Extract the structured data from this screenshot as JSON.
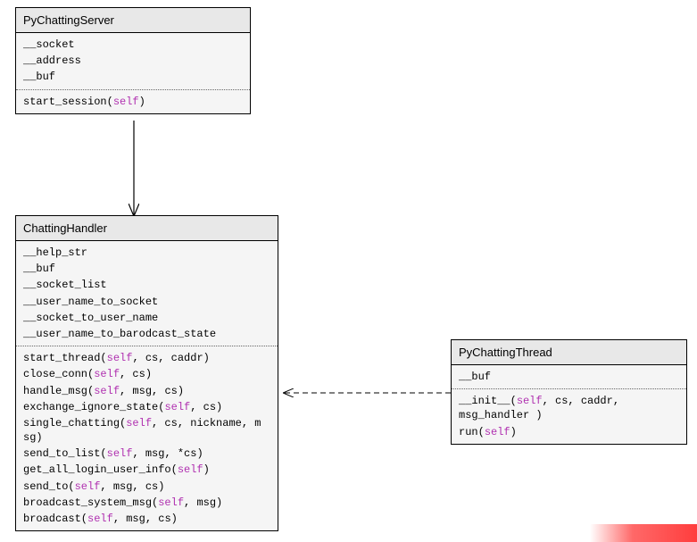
{
  "classes": {
    "server": {
      "name": "PyChattingServer",
      "attrs": [
        "__socket",
        "__address",
        "__buf"
      ],
      "methods": [
        [
          [
            "start_session("
          ],
          [
            "self",
            true
          ],
          [
            ")"
          ]
        ]
      ]
    },
    "handler": {
      "name": "ChattingHandler",
      "attrs": [
        "__help_str",
        "__buf",
        "__socket_list",
        "__user_name_to_socket",
        "__socket_to_user_name",
        "__user_name_to_barodcast_state"
      ],
      "methods": [
        [
          [
            "start_thread("
          ],
          [
            "self",
            true
          ],
          [
            ", cs, caddr)"
          ]
        ],
        [
          [
            "close_conn("
          ],
          [
            "self",
            true
          ],
          [
            ", cs)"
          ]
        ],
        [
          [
            "handle_msg("
          ],
          [
            "self",
            true
          ],
          [
            ", msg, cs)"
          ]
        ],
        [
          [
            "exchange_ignore_state("
          ],
          [
            "self",
            true
          ],
          [
            ", cs)"
          ]
        ],
        [
          [
            "single_chatting("
          ],
          [
            "self",
            true
          ],
          [
            ", cs, nickname, m\nsg)"
          ]
        ],
        [
          [
            "send_to_list("
          ],
          [
            "self",
            true
          ],
          [
            ", msg, *cs)"
          ]
        ],
        [
          [
            "get_all_login_user_info("
          ],
          [
            "self",
            true
          ],
          [
            ")"
          ]
        ],
        [
          [
            "send_to("
          ],
          [
            "self",
            true
          ],
          [
            ", msg, cs)"
          ]
        ],
        [
          [
            "broadcast_system_msg("
          ],
          [
            "self",
            true
          ],
          [
            ", msg)"
          ]
        ],
        [
          [
            "broadcast("
          ],
          [
            "self",
            true
          ],
          [
            ", msg, cs)"
          ]
        ]
      ]
    },
    "thread": {
      "name": "PyChattingThread",
      "attrs": [
        "__buf"
      ],
      "methods": [
        [
          [
            "__init__("
          ],
          [
            "self",
            true
          ],
          [
            ", cs, caddr, msg_handler\n)"
          ]
        ],
        [
          [
            "run("
          ],
          [
            "self",
            true
          ],
          [
            ")"
          ]
        ]
      ]
    }
  }
}
